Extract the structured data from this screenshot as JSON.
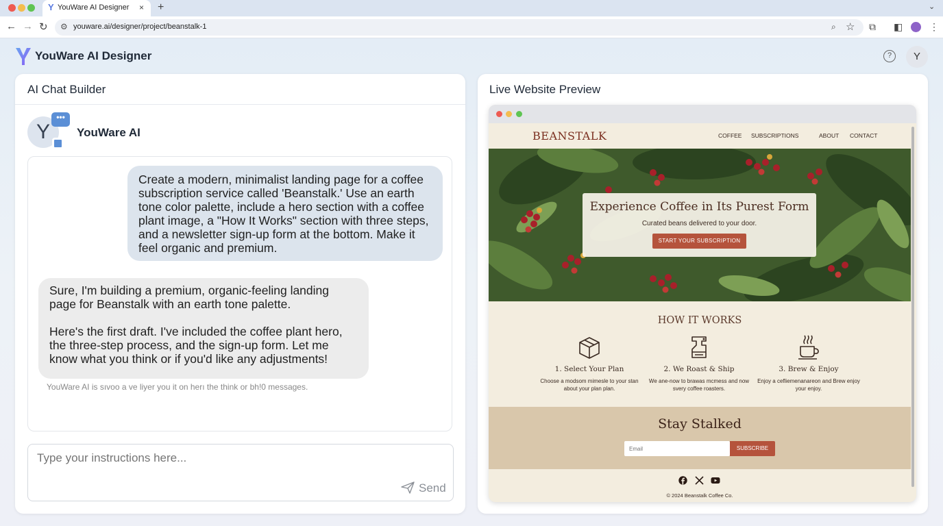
{
  "browser": {
    "tab_title": "YouWare AI Designer",
    "tab_close": "×",
    "new_tab": "+",
    "url": "youware.ai/designer/project/beanstalk-1",
    "profile_initial": ""
  },
  "app": {
    "name": "YouWare AI Designer",
    "help": "?",
    "user_initial": "Y"
  },
  "chat": {
    "title": "AI Chat Builder",
    "ai_name": "YouWare AI",
    "ai_initial": "Y",
    "bubble_dots": "•••",
    "user_message": "Create a modern, minimalist landing page for a coffee subscription service called 'Beanstalk.' Use an earth tone color palette, include a hero section with a coffee plant image, a \"How It Works\" section with three steps, and a newsletter sign-up form at the bottom. Make it feel organic and premium.",
    "ai_message": "Sure, I'm building a premium, organic-feeling landing page for Beanstalk with an earth tone palette.\n\nHere's the first draft. I've included the coffee plant hero, the three-step process, and the sign-up form. Let me know what you think or if you'd like any adjustments!",
    "footnote": "YouWare AI is sıvoo a ve liyer you it on herı the think or bh!0 messages.",
    "input_placeholder": "Type your instructions here...",
    "send_label": "Send"
  },
  "preview": {
    "title": "Live Website Preview",
    "site": {
      "brand": "BEANSTALK",
      "nav": [
        "COFFEE",
        "SUBSCRIPTIONS",
        "ABOUT",
        "CONTACT"
      ],
      "hero_heading": "Experience Coffee in Its Purest Form",
      "hero_subtitle": "Curated beans delivered to your door.",
      "hero_button": "START YOUR SUBSCRIPTION",
      "how_heading": "HOW IT WORKS",
      "steps": [
        {
          "title": "1. Select Your Plan",
          "desc": "Choose a modsom mimesle to your stan about your plan plan.",
          "icon": "box-icon"
        },
        {
          "title": "2. We Roast & Ship",
          "desc": "We ane-now to brawas mcmess and now svery coffee roasters.",
          "icon": "roaster-icon"
        },
        {
          "title": "3. Brew & Enjoy",
          "desc": "Enjoy a cefliemenanareon and Brew enjoy your enjoy.",
          "icon": "coffee-cup-icon"
        }
      ],
      "newsletter_heading": "Stay Stalked",
      "email_placeholder": "Email",
      "subscribe_button": "SUBSCRIBE",
      "social": [
        "facebook-icon",
        "x-icon",
        "youtube-icon"
      ],
      "copyright": "© 2024 Beanstalk Coffee Co."
    }
  },
  "colors": {
    "accent": "#b5533c",
    "brand": "#7a2e1f",
    "cream": "#f3eddf",
    "sand": "#d9c7ab",
    "chat_user_bubble": "#dce4ed",
    "chat_ai_bubble": "#ececec"
  }
}
